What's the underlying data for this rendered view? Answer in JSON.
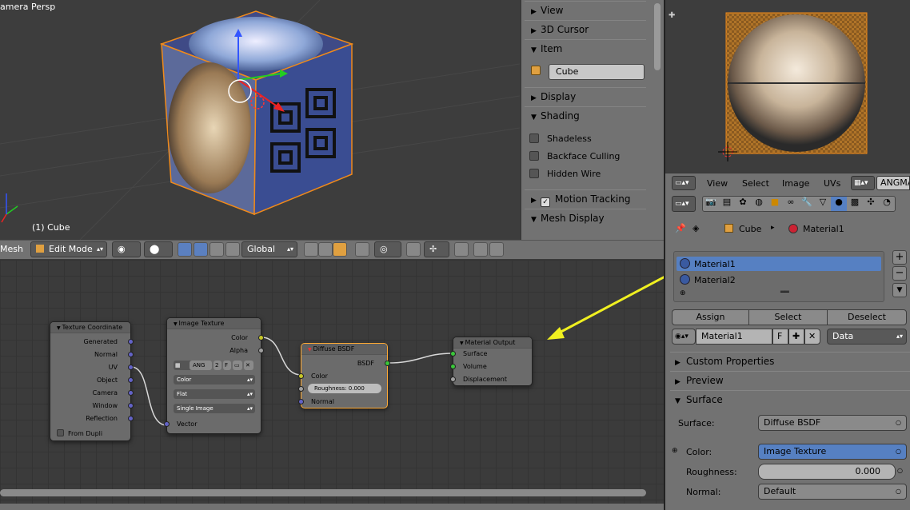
{
  "viewport": {
    "view_label": "amera Persp",
    "object_label": "(1) Cube"
  },
  "n_panel": {
    "sections": [
      {
        "label": "View",
        "open": false
      },
      {
        "label": "3D Cursor",
        "open": false
      },
      {
        "label": "Item",
        "open": true
      },
      {
        "label": "Display",
        "open": false
      },
      {
        "label": "Shading",
        "open": true
      },
      {
        "label": "Motion Tracking",
        "open": false
      },
      {
        "label": "Mesh Display",
        "open": true
      }
    ],
    "item_name": "Cube",
    "shading_options": [
      "Shadeless",
      "Backface Culling",
      "Hidden Wire"
    ]
  },
  "header": {
    "menu_label": "Mesh",
    "mode": "Edit Mode",
    "orientation": "Global"
  },
  "nodes": {
    "texture_coordinate": {
      "title": "Texture Coordinate",
      "outputs": [
        "Generated",
        "Normal",
        "UV",
        "Object",
        "Camera",
        "Window",
        "Reflection"
      ],
      "checkbox": "From Dupli"
    },
    "image_texture": {
      "title": "Image Texture",
      "outputs": [
        "Color",
        "Alpha"
      ],
      "image_name": "ANG",
      "users": "2",
      "fake": "F",
      "color_space": "Color",
      "projection": "Flat",
      "source": "Single Image",
      "input": "Vector"
    },
    "diffuse_bsdf": {
      "title": "Diffuse BSDF",
      "output": "BSDF",
      "inputs": [
        "Color",
        "Normal"
      ],
      "roughness_label": "Roughness:",
      "roughness_value": "0.000"
    },
    "material_output": {
      "title": "Material Output",
      "inputs": [
        "Surface",
        "Volume",
        "Displacement"
      ]
    }
  },
  "image_editor_header": {
    "menus": [
      "View",
      "Select",
      "Image",
      "UVs"
    ],
    "image_name": "ANGMA"
  },
  "properties": {
    "breadcrumb": {
      "object": "Cube",
      "material": "Material1"
    },
    "material_slots": [
      "Material1",
      "Material2"
    ],
    "slot_buttons": {
      "assign": "Assign",
      "select": "Select",
      "deselect": "Deselect"
    },
    "material_name": "Material1",
    "fake_user": "F",
    "link": "Data",
    "panels": {
      "custom_properties": "Custom Properties",
      "preview": "Preview",
      "surface": "Surface"
    },
    "surface": {
      "surface_label": "Surface:",
      "surface_value": "Diffuse BSDF",
      "color_label": "Color:",
      "color_value": "Image Texture",
      "roughness_label": "Roughness:",
      "roughness_value": "0.000",
      "normal_label": "Normal:",
      "normal_value": "Default"
    }
  },
  "colors": {
    "selection": "#5680c2",
    "annotation_arrow": "#f0f020",
    "node_selected_border": "#ffaa33"
  }
}
